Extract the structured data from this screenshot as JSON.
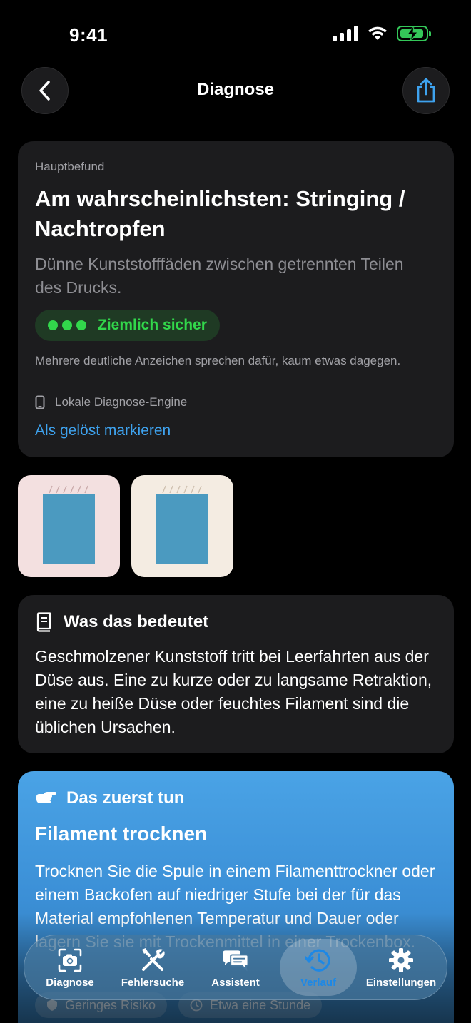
{
  "status_bar": {
    "time": "9:41"
  },
  "nav": {
    "title": "Diagnose"
  },
  "primary_finding": {
    "overline": "Hauptbefund",
    "headline": "Am wahrscheinlichsten: Stringing / Nachtropfen",
    "summary": "Dünne Kunststofffäden zwischen getrennten Teilen des Drucks.",
    "confidence": {
      "label": "Ziemlich sicher",
      "level": 3,
      "max": 3,
      "color": "#32d74b"
    },
    "explanation": "Mehrere deutliche Anzeichen sprechen dafür, kaum etwas dagegen.",
    "engine": "Lokale Diagnose-Engine",
    "resolve_link": "Als gelöst markieren"
  },
  "meaning": {
    "heading": "Was das bedeutet",
    "body": "Geschmolzener Kunststoff tritt bei Leer­fahrten aus der Düse aus. Eine zu kurze oder zu langsame Retraktion, eine zu heiße Düse oder feuchtes Filament sind die üblichen Ursachen."
  },
  "first_action": {
    "heading": "Das zuerst tun",
    "title": "Filament trocknen",
    "body": "Trocknen Sie die Spule in einem Filamenttrockner oder einem Backofen auf niedriger Stufe bei der für das Material empfohlenen Temperatur und Dauer oder lagern Sie sie mit Trockenmittel in einer Trockenbox.",
    "chips": [
      {
        "label": "Geringes Risiko",
        "icon": "shield-icon"
      },
      {
        "label": "Etwa eine Stunde",
        "icon": "clock-icon"
      }
    ]
  },
  "tabs": [
    {
      "label": "Diagnose",
      "icon": "camera-scan-icon",
      "active": false
    },
    {
      "label": "Fehlersuche",
      "icon": "tools-icon",
      "active": false
    },
    {
      "label": "Assistent",
      "icon": "chat-bubbles-icon",
      "active": false
    },
    {
      "label": "Verlauf",
      "icon": "history-icon",
      "active": true
    },
    {
      "label": "Einstellungen",
      "icon": "gear-icon",
      "active": false
    }
  ],
  "colors": {
    "accent": "#3ea2ee",
    "success": "#32d74b",
    "card": "#1c1c1e",
    "action_card": "#4aa3e6"
  }
}
